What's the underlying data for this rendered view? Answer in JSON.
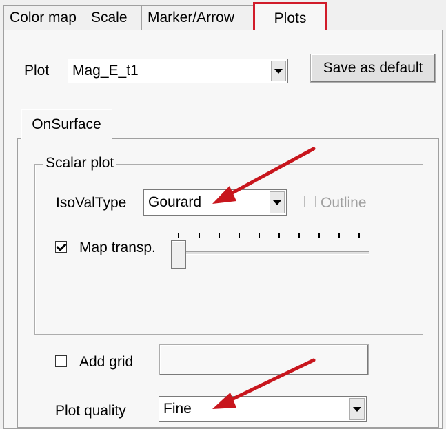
{
  "tabs": [
    {
      "label": "Color map",
      "active": false
    },
    {
      "label": "Scale",
      "active": false
    },
    {
      "label": "Marker/Arrow",
      "active": false
    },
    {
      "label": "Plots",
      "active": true
    }
  ],
  "plot": {
    "label": "Plot",
    "value": "Mag_E_t1",
    "save_default_label": "Save as default"
  },
  "subtab": {
    "label": "OnSurface"
  },
  "scalar_plot": {
    "title": "Scalar plot",
    "isoval_label": "IsoValType",
    "isoval_value": "Gourard",
    "outline_label": "Outline",
    "outline_checked": false,
    "outline_enabled": false,
    "map_transp_label": "Map transp.",
    "map_transp_checked": true,
    "transparency_level": 0
  },
  "add_grid": {
    "label": "Add grid",
    "checked": false
  },
  "plot_quality": {
    "label": "Plot quality",
    "value": "Fine"
  },
  "colors": {
    "highlight": "#d11c2a",
    "arrow": "#c8161d"
  },
  "icons": [
    "chevron-down-icon",
    "checkmark-icon",
    "annotation-arrow-icon"
  ]
}
